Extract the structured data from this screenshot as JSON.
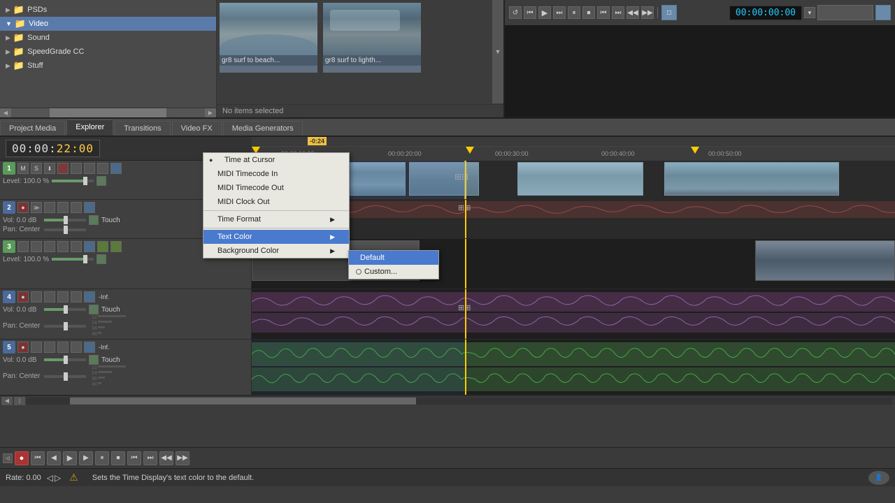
{
  "topPanel": {
    "folders": [
      {
        "name": "PSDs",
        "type": "folder",
        "expanded": false
      },
      {
        "name": "Video",
        "type": "folder",
        "expanded": true,
        "active": true
      },
      {
        "name": "Sound",
        "type": "folder",
        "expanded": false
      },
      {
        "name": "SpeedGrade CC",
        "type": "folder",
        "expanded": false
      },
      {
        "name": "Stuff",
        "type": "folder",
        "expanded": false
      }
    ],
    "thumbnails": [
      {
        "label": "gr8 surf to beach...",
        "type": "ocean"
      },
      {
        "label": "gr8 surf to lighth...",
        "type": "ocean"
      }
    ],
    "noItemsText": "No items selected"
  },
  "tabs": [
    {
      "id": "project-media",
      "label": "Project Media",
      "active": false
    },
    {
      "id": "explorer",
      "label": "Explorer",
      "active": true
    },
    {
      "id": "transitions",
      "label": "Transitions",
      "active": false
    },
    {
      "id": "video-fx",
      "label": "Video FX",
      "active": false
    },
    {
      "id": "media-generators",
      "label": "Media Generators",
      "active": false
    }
  ],
  "previewTimecode": "00:00:00:00",
  "timelineTimecode": "00:00:",
  "timelineMarker": "-0:24",
  "rulerMarks": [
    "00:00:10:00",
    "00:00:20:00",
    "00:00:30:00",
    "00:00:40:00",
    "00:00:50:00"
  ],
  "tracks": [
    {
      "id": 1,
      "num": "1",
      "type": "video",
      "level": "Level: 100.0 %",
      "color": "#5a9a5a"
    },
    {
      "id": 2,
      "num": "2",
      "type": "audio",
      "vol": "Vol:  0.0 dB",
      "pan": "Pan:    Center",
      "touch": "Touch",
      "color": "#4a6a9a"
    },
    {
      "id": 3,
      "num": "3",
      "type": "video",
      "level": "Level: 100.0 %",
      "color": "#5a9a5a"
    },
    {
      "id": 4,
      "num": "4",
      "type": "audio",
      "vol": "Vol:  0.0 dB",
      "pan": "Pan:    Center",
      "touch": "Touch",
      "color": "#4a6a9a"
    },
    {
      "id": 5,
      "num": "5",
      "type": "audio",
      "vol": "Vol:  0.0 dB",
      "pan": "Pan:    Center",
      "touch": "Touch",
      "color": "#4a6a9a"
    }
  ],
  "contextMenu": {
    "items": [
      {
        "label": "Time at Cursor",
        "type": "item",
        "checked": true
      },
      {
        "label": "MIDI Timecode In",
        "type": "item"
      },
      {
        "label": "MIDI Timecode Out",
        "type": "item"
      },
      {
        "label": "MIDI Clock Out",
        "type": "item"
      },
      {
        "type": "separator"
      },
      {
        "label": "Time Format",
        "type": "submenu"
      },
      {
        "type": "separator"
      },
      {
        "label": "Text Color",
        "type": "submenu",
        "highlighted": true
      },
      {
        "label": "Background Color",
        "type": "submenu"
      }
    ]
  },
  "textColorSubmenu": {
    "items": [
      {
        "label": "Default",
        "type": "item",
        "highlighted": true
      },
      {
        "label": "Custom...",
        "type": "item",
        "dotted": true
      }
    ]
  },
  "statusBar": {
    "rateLabel": "Rate: 0.00",
    "tooltipText": "Sets the Time Display's text color to the default."
  },
  "bottomTransport": {
    "buttons": [
      "rec",
      "rewind",
      "prev-frame",
      "play",
      "next-frame",
      "stop",
      "pause",
      "loop",
      "prev-marker",
      "next-marker",
      "slow-left",
      "slow-right"
    ]
  }
}
